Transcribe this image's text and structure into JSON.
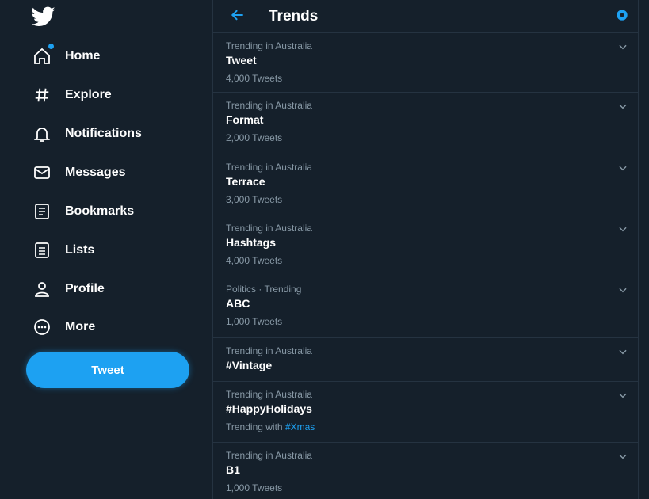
{
  "colors": {
    "background": "#15202b",
    "accent": "#1da1f2",
    "border": "#253341",
    "secondary_text": "#8899a6"
  },
  "sidebar": {
    "logo_icon": "bird-icon",
    "items": [
      {
        "label": "Home",
        "icon": "home-icon",
        "has_dot": true
      },
      {
        "label": "Explore",
        "icon": "hashtag-icon"
      },
      {
        "label": "Notifications",
        "icon": "bell-icon"
      },
      {
        "label": "Messages",
        "icon": "envelope-icon"
      },
      {
        "label": "Bookmarks",
        "icon": "bookmark-icon"
      },
      {
        "label": "Lists",
        "icon": "list-icon"
      },
      {
        "label": "Profile",
        "icon": "person-icon"
      },
      {
        "label": "More",
        "icon": "more-icon"
      }
    ],
    "tweet_button": "Tweet"
  },
  "header": {
    "title": "Trends"
  },
  "trends": [
    {
      "context": "Trending in Australia",
      "name": "Tweet",
      "count": "4,000 Tweets"
    },
    {
      "context": "Trending in Australia",
      "name": "Format",
      "count": "2,000 Tweets"
    },
    {
      "context": "Trending in Australia",
      "name": "Terrace",
      "count": "3,000 Tweets"
    },
    {
      "context": "Trending in Australia",
      "name": "Hashtags",
      "count": "4,000 Tweets"
    },
    {
      "context": "Politics · Trending",
      "name": "ABC",
      "count": "1,000 Tweets"
    },
    {
      "context": "Trending in Australia",
      "name": "#Vintage"
    },
    {
      "context": "Trending in Australia",
      "name": "#HappyHolidays",
      "count": "Trending with",
      "count_accent": "#Xmas"
    },
    {
      "context": "Trending in Australia",
      "name": "B1",
      "count": "1,000 Tweets"
    }
  ]
}
